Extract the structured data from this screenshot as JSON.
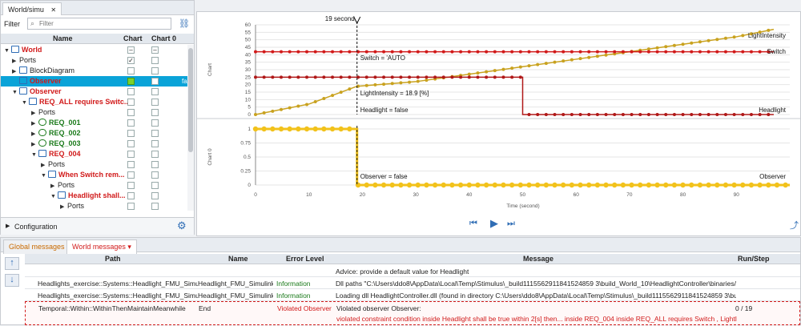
{
  "window_tab": "World/simu",
  "filter": {
    "label": "Filter",
    "placeholder": "Filter"
  },
  "tree": {
    "columns": [
      "Name",
      "Chart",
      "Chart 0"
    ],
    "rows": [
      {
        "label": "World",
        "style": "red",
        "arrow": "▼",
        "chart": "dash",
        "chart0": "dash"
      },
      {
        "label": "Ports",
        "style": "",
        "arrow": "▶",
        "chart": "check",
        "chart0": ""
      },
      {
        "label": "BlockDiagram",
        "style": "",
        "arrow": "▶",
        "chart": "",
        "chart0": ""
      },
      {
        "label": "Observer",
        "style": "red",
        "arrow": "",
        "chart": "green",
        "chart0": "check",
        "extra": "fal"
      },
      {
        "label": "Observer",
        "style": "red",
        "arrow": "▼",
        "chart": "",
        "chart0": ""
      },
      {
        "label": "REQ_ALL requires Switc...",
        "style": "red",
        "arrow": "▼",
        "chart": "",
        "chart0": ""
      },
      {
        "label": "Ports",
        "style": "",
        "arrow": "▶",
        "chart": "",
        "chart0": ""
      },
      {
        "label": "REQ_001",
        "style": "green",
        "arrow": "▶",
        "chart": "",
        "chart0": ""
      },
      {
        "label": "REQ_002",
        "style": "green",
        "arrow": "▶",
        "chart": "",
        "chart0": ""
      },
      {
        "label": "REQ_003",
        "style": "green",
        "arrow": "▶",
        "chart": "",
        "chart0": ""
      },
      {
        "label": "REQ_004",
        "style": "red",
        "arrow": "▼",
        "chart": "",
        "chart0": ""
      },
      {
        "label": "Ports",
        "style": "",
        "arrow": "▶",
        "chart": "",
        "chart0": ""
      },
      {
        "label": "When Switch rem...",
        "style": "red",
        "arrow": "▼",
        "chart": "",
        "chart0": ""
      },
      {
        "label": "Ports",
        "style": "",
        "arrow": "▶",
        "chart": "",
        "chart0": ""
      },
      {
        "label": "Headlight shall...",
        "style": "red",
        "arrow": "▼",
        "chart": "",
        "chart0": ""
      },
      {
        "label": "Ports",
        "style": "",
        "arrow": "▶",
        "chart": "",
        "chart0": ""
      }
    ]
  },
  "configuration": "Configuration",
  "cursor_label": "19 second",
  "chart_data": [
    {
      "type": "line",
      "title": "",
      "ylabel": "Chart",
      "xlim": [
        0,
        100
      ],
      "ylim": [
        0,
        60
      ],
      "yticks": [
        "0",
        "5",
        "10",
        "15",
        "20",
        "25",
        "30",
        "35",
        "40",
        "45",
        "50",
        "55",
        "60"
      ],
      "series": [
        {
          "name": "LightIntensity",
          "color": "#c9a21f",
          "x": [
            0,
            10,
            19,
            30,
            40,
            50,
            60,
            70,
            80,
            90,
            97
          ],
          "values": [
            0,
            7,
            18.9,
            22,
            27,
            32,
            37,
            42,
            47,
            52,
            57
          ]
        },
        {
          "name": "Switch",
          "color": "#d11a1a",
          "x": [
            0,
            19,
            50,
            97
          ],
          "values": [
            42,
            42,
            42,
            42
          ]
        },
        {
          "name": "Headlight",
          "color": "#b01818",
          "x": [
            0,
            19,
            50,
            97
          ],
          "values": [
            25,
            25,
            0,
            0
          ]
        }
      ],
      "annotations": [
        "Switch = 'AUTO",
        "LightIntensity = 18.9 [%]",
        "Headlight = false",
        "LightIntensity",
        "Switch",
        "Headlight"
      ]
    },
    {
      "type": "line",
      "title": "",
      "ylabel": "Chart 0",
      "xlabel": "Time (second)",
      "xlim": [
        0,
        100
      ],
      "ylim": [
        0,
        1
      ],
      "yticks": [
        "0",
        "0.25",
        "0.5",
        "0.75",
        "1"
      ],
      "xticks": [
        "0",
        "10",
        "20",
        "30",
        "40",
        "50",
        "60",
        "70",
        "80",
        "90"
      ],
      "series": [
        {
          "name": "Observer",
          "color": "#f2c21b",
          "x": [
            0,
            19,
            19,
            100
          ],
          "values": [
            1,
            1,
            0,
            0
          ]
        }
      ],
      "annotations": [
        "Observer = false",
        "Observer"
      ]
    }
  ],
  "messages": {
    "tabs": [
      "Global messages",
      "World messages"
    ],
    "columns": [
      "Path",
      "Name",
      "Error Level",
      "Message",
      "Run/Step"
    ],
    "rows": [
      {
        "path": "",
        "name": "",
        "level": "",
        "msg": "Advice: provide a default value for Headlight",
        "run": ""
      },
      {
        "path": "Headlights_exercise::Systems::Headlight_FMU_Simulink",
        "name": "Headlight_FMU_Simulink",
        "level": "Information",
        "msg": "Dll paths \"C:\\Users\\ddo8\\AppData\\Local\\Temp\\Stimulus\\_build1115562911841524859 3\\build_World_10\\HeadlightController\\binaries/win64\" a",
        "run": ""
      },
      {
        "path": "Headlights_exercise::Systems::Headlight_FMU_Simulink",
        "name": "Headlight_FMU_Simulink",
        "level": "Information",
        "msg": "Loading dll HeadlightController.dll (found in directory C:\\Users\\ddo8\\AppData\\Local\\Temp\\Stimulus\\_build1115562911841524859 3\\bu",
        "run": ""
      },
      {
        "path": "Temporal::Within::WithinThenMaintainMeanwhile",
        "name": "End",
        "level": "Violated Observer",
        "msg": "Violated observer Observer:",
        "msg2": "violated constraint condition inside Headlight shall be true within 2[s] then... inside REQ_004 inside REQ_ALL requires Switch , LightIntensity...",
        "run": "0 / 19"
      }
    ]
  }
}
